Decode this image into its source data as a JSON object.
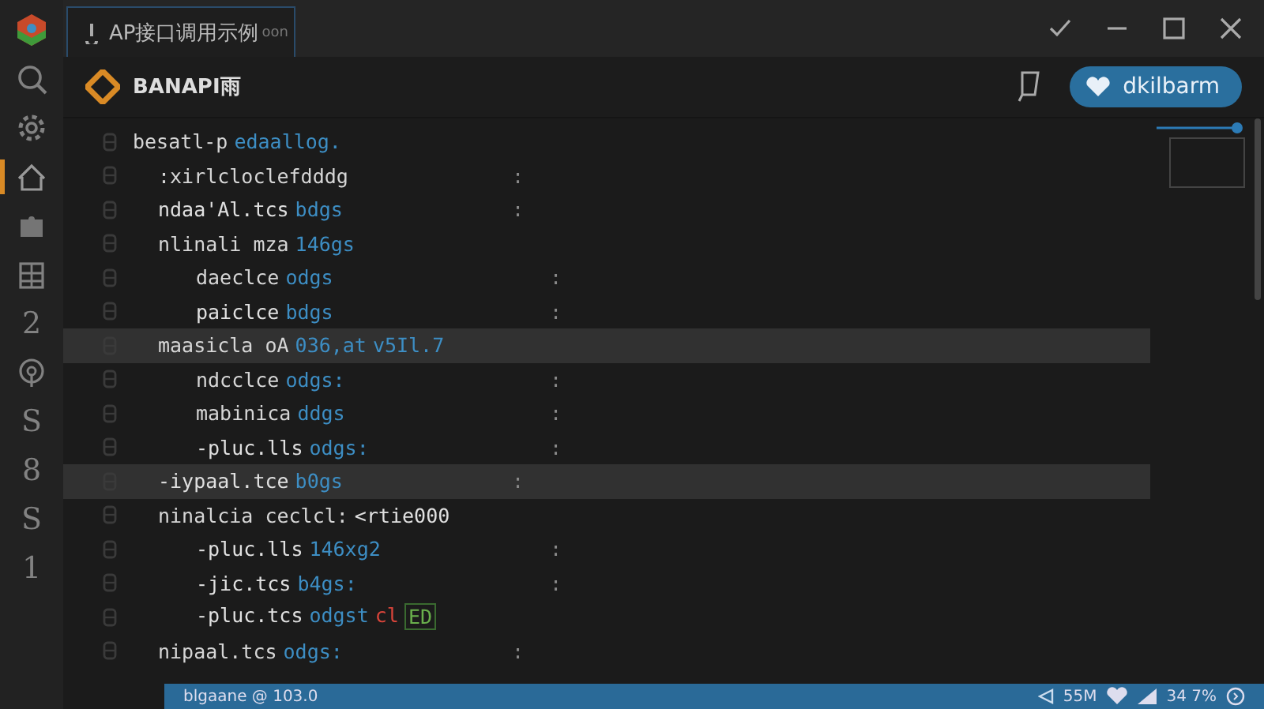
{
  "window": {
    "tab_title": "AP接口调用示例",
    "tab_suffix": "oon"
  },
  "header": {
    "project": "BANAPI雨",
    "account": "dkilbarm"
  },
  "activity": [
    {
      "kind": "search",
      "selected": false
    },
    {
      "kind": "gear",
      "selected": false
    },
    {
      "kind": "home",
      "selected": true
    },
    {
      "kind": "puzzle",
      "selected": false
    },
    {
      "kind": "grid",
      "selected": false
    },
    {
      "kind": "text",
      "label": "2",
      "selected": false
    },
    {
      "kind": "pin",
      "selected": false
    },
    {
      "kind": "text",
      "label": "S",
      "selected": false
    },
    {
      "kind": "text",
      "label": "8",
      "selected": false
    },
    {
      "kind": "text",
      "label": "S",
      "selected": false
    },
    {
      "kind": "text",
      "label": "1",
      "selected": false
    }
  ],
  "lines": [
    {
      "selected": false,
      "tokens": [
        {
          "text": "besatl-p",
          "kind": "plain"
        },
        {
          "text": "edaallog.",
          "kind": "value"
        }
      ],
      "children": [
        {
          "selected": false,
          "mark": ":",
          "tokens": [
            {
              "text": ":xirlcloclefdddg",
              "kind": "plain"
            }
          ]
        },
        {
          "selected": false,
          "mark": ":",
          "tokens": [
            {
              "text": "ndaa'Al.tcs",
              "kind": "string"
            },
            {
              "text": "bdgs",
              "kind": "value"
            }
          ]
        },
        {
          "selected": false,
          "tokens": [
            {
              "text": "nlinali mza",
              "kind": "plain"
            },
            {
              "text": "146gs",
              "kind": "value"
            }
          ],
          "children": [
            {
              "selected": false,
              "mark": ":",
              "tokens": [
                {
                  "text": "daeclce",
                  "kind": "plain"
                },
                {
                  "text": "odgs",
                  "kind": "value"
                }
              ]
            },
            {
              "selected": false,
              "mark": ":",
              "tokens": [
                {
                  "text": "paiclce",
                  "kind": "string"
                },
                {
                  "text": "bdgs",
                  "kind": "value"
                }
              ]
            }
          ]
        },
        {
          "selected": true,
          "tokens": [
            {
              "text": "maasicla oA",
              "kind": "plain"
            },
            {
              "text": "036,at",
              "kind": "value"
            },
            {
              "text": "v5Il.7",
              "kind": "value"
            }
          ],
          "children": [
            {
              "selected": false,
              "mark": ":",
              "tokens": [
                {
                  "text": "ndcclce",
                  "kind": "plain"
                },
                {
                  "text": "odgs:",
                  "kind": "value"
                }
              ]
            },
            {
              "selected": false,
              "mark": ":",
              "tokens": [
                {
                  "text": "mabinica",
                  "kind": "plain"
                },
                {
                  "text": "ddgs",
                  "kind": "value"
                }
              ]
            },
            {
              "selected": false,
              "mark": ":",
              "tokens": [
                {
                  "text": "-pluc.lls",
                  "kind": "string"
                },
                {
                  "text": "odgs:",
                  "kind": "value"
                }
              ]
            }
          ]
        },
        {
          "selected": true,
          "mark": ":",
          "tokens": [
            {
              "text": "-iypaal.tce",
              "kind": "string"
            },
            {
              "text": "b0gs",
              "kind": "value"
            }
          ]
        },
        {
          "selected": false,
          "tokens": [
            {
              "text": "ninalcia ceclcl:",
              "kind": "plain"
            },
            {
              "text": "<rtie000",
              "kind": "string"
            }
          ],
          "children": [
            {
              "selected": false,
              "mark": ":",
              "tokens": [
                {
                  "text": "-pluc.lls",
                  "kind": "string"
                },
                {
                  "text": "146xg2",
                  "kind": "value"
                }
              ]
            },
            {
              "selected": false,
              "mark": ":",
              "tokens": [
                {
                  "text": "-jic.tcs",
                  "kind": "string"
                },
                {
                  "text": "b4gs:",
                  "kind": "value"
                }
              ]
            },
            {
              "selected": false,
              "tokens": [
                {
                  "text": "-pluc.tcs",
                  "kind": "string"
                },
                {
                  "text": "odgst",
                  "kind": "value"
                },
                {
                  "text": "cl",
                  "kind": "error"
                },
                {
                  "text": "ED",
                  "kind": "ok"
                }
              ]
            }
          ]
        },
        {
          "selected": false,
          "mark": ":",
          "tokens": [
            {
              "text": "nipaal.tcs",
              "kind": "plain"
            },
            {
              "text": "odgs:",
              "kind": "value"
            }
          ]
        }
      ]
    }
  ],
  "status": {
    "branch": "blgaane @ 103.0",
    "speed": "55M",
    "battery": "34 7%"
  }
}
